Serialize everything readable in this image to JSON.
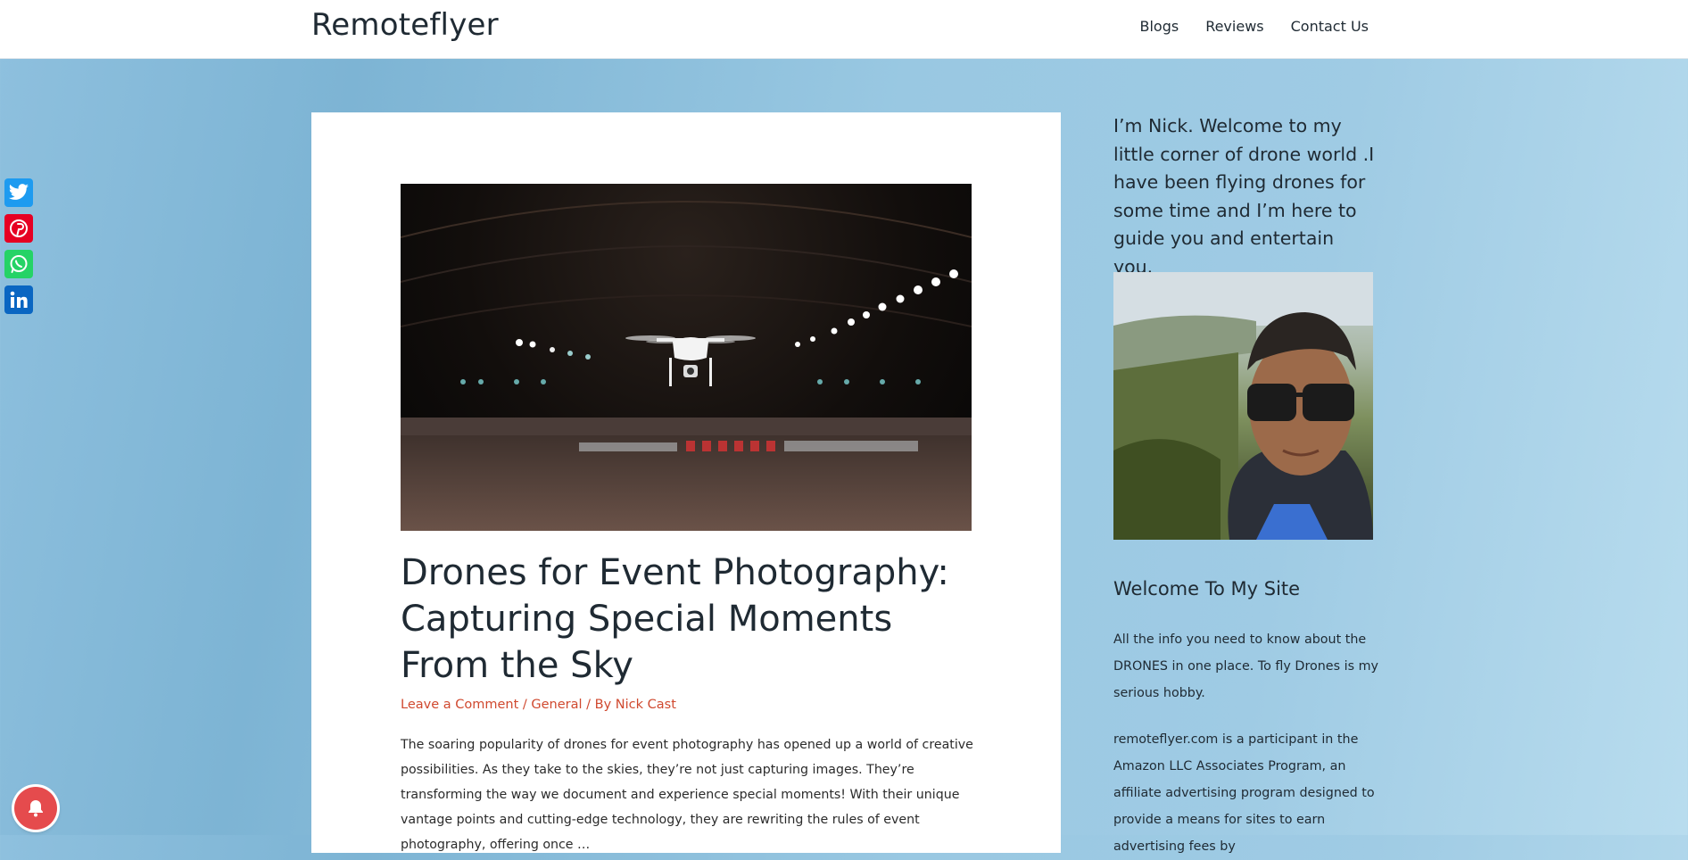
{
  "site": {
    "title": "Remoteflyer"
  },
  "nav": {
    "items": [
      "Blogs",
      "Reviews",
      "Contact Us"
    ]
  },
  "social": {
    "icons": [
      "twitter-icon",
      "pinterest-icon",
      "whatsapp-icon",
      "linkedin-icon"
    ]
  },
  "post": {
    "title": "Drones for Event Photography: Capturing Special Moments From the Sky",
    "meta": {
      "comment_link": "Leave a Comment",
      "sep1": " / ",
      "category": "General",
      "sep2": " / By ",
      "author": "Nick Cast"
    },
    "excerpt": "The soaring popularity of drones for event photography has opened up a world of creative possibilities. As they take to the skies, they’re not just capturing images. They’re transforming the way we document and experience special moments! With their unique vantage points and cutting-edge technology, they are rewriting the rules of event photography, offering once …"
  },
  "sidebar": {
    "intro": "I’m Nick. Welcome to my little corner of drone world .I have been flying drones for some time and I’m here to guide you and entertain you.",
    "heading": "Welcome To My Site",
    "text1": "All the info you need to know about the DRONES in one place. To fly Drones is my serious hobby.",
    "text2": "remoteflyer.com is a participant in the Amazon LLC Associates Program, an affiliate advertising program designed to provide a means for sites to earn advertising fees by"
  },
  "colors": {
    "accent": "#d0492f",
    "background": "#9fcbe4",
    "bell": "#e54b4d"
  }
}
